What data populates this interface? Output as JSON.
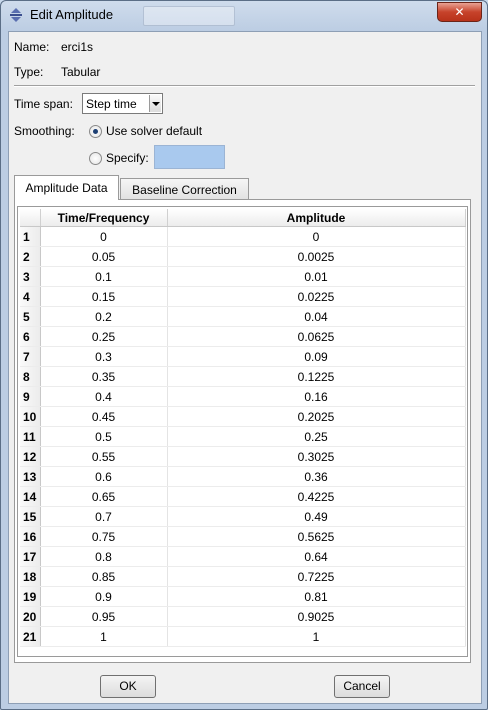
{
  "window": {
    "title": "Edit Amplitude",
    "close_glyph": "✕"
  },
  "fields": {
    "name_label": "Name:",
    "name_value": "erci1s",
    "type_label": "Type:",
    "type_value": "Tabular"
  },
  "time_span": {
    "label": "Time span:",
    "value": "Step time"
  },
  "smoothing": {
    "label": "Smoothing:",
    "option_default": "Use solver default",
    "option_specify": "Specify:",
    "specify_value": ""
  },
  "tabs": [
    {
      "label": "Amplitude Data"
    },
    {
      "label": "Baseline Correction"
    }
  ],
  "table": {
    "columns": [
      "Time/Frequency",
      "Amplitude"
    ],
    "rows": [
      [
        "1",
        "0",
        "0"
      ],
      [
        "2",
        "0.05",
        "0.0025"
      ],
      [
        "3",
        "0.1",
        "0.01"
      ],
      [
        "4",
        "0.15",
        "0.0225"
      ],
      [
        "5",
        "0.2",
        "0.04"
      ],
      [
        "6",
        "0.25",
        "0.0625"
      ],
      [
        "7",
        "0.3",
        "0.09"
      ],
      [
        "8",
        "0.35",
        "0.1225"
      ],
      [
        "9",
        "0.4",
        "0.16"
      ],
      [
        "10",
        "0.45",
        "0.2025"
      ],
      [
        "11",
        "0.5",
        "0.25"
      ],
      [
        "12",
        "0.55",
        "0.3025"
      ],
      [
        "13",
        "0.6",
        "0.36"
      ],
      [
        "14",
        "0.65",
        "0.4225"
      ],
      [
        "15",
        "0.7",
        "0.49"
      ],
      [
        "16",
        "0.75",
        "0.5625"
      ],
      [
        "17",
        "0.8",
        "0.64"
      ],
      [
        "18",
        "0.85",
        "0.7225"
      ],
      [
        "19",
        "0.9",
        "0.81"
      ],
      [
        "20",
        "0.95",
        "0.9025"
      ],
      [
        "21",
        "1",
        "1"
      ]
    ]
  },
  "buttons": {
    "ok": "OK",
    "cancel": "Cancel"
  },
  "colors": {
    "frame": "#bccde3",
    "specify_field": "#a9c9ee",
    "close_button": "#c7432b"
  }
}
